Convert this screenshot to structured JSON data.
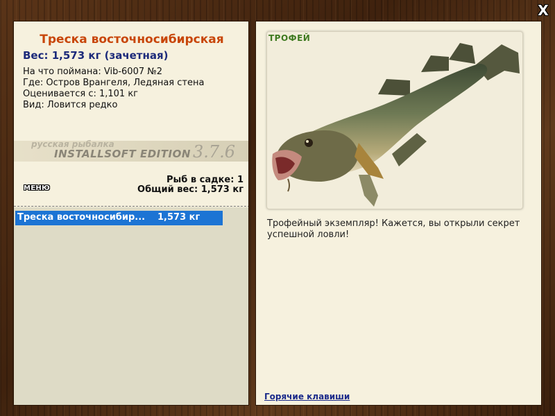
{
  "window": {
    "close_label": "X"
  },
  "fish": {
    "name": "Треска восточносибирская",
    "weight_line": "Вес: 1,573 кг (зачетная)",
    "caught_on": "На что поймана: Vib-6007 №2",
    "location": "Где: Остров Врангеля, Ледяная стена",
    "valued_from": "Оценивается с: 1,101 кг",
    "kind": "Вид: Ловится редко"
  },
  "logo": {
    "small": "русская рыбалка",
    "edition": "INSTALLSOFT EDITION",
    "version": "3.7.6"
  },
  "stats": {
    "count": "Рыб в садке: 1",
    "total_weight": "Общий вес: 1,573 кг"
  },
  "menu": {
    "label": "МЕНЮ"
  },
  "catch_list": [
    {
      "name": "Треска восточносибир...",
      "weight": "1,573 кг",
      "selected": true
    }
  ],
  "trophy": {
    "badge": "ТРОФЕЙ",
    "description": "Трофейный экземпляр! Кажется, вы открыли секрет успешной ловли!"
  },
  "footer": {
    "hotkeys_link": "Горячие клавиши"
  },
  "colors": {
    "title": "#c8460a",
    "weight": "#1c2a7a",
    "selection": "#1c74d4",
    "trophy_badge": "#3f7a21",
    "link": "#1a2a8a"
  },
  "icons": {
    "close": "close-icon",
    "fish_photo": "fish-photo"
  }
}
